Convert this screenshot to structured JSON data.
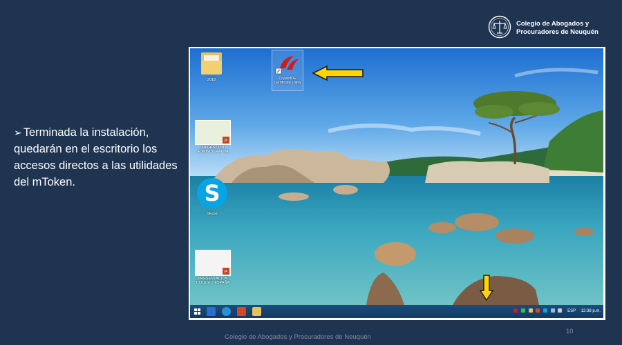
{
  "logo": {
    "line1": "Colegio de Abogados y",
    "line2": "Procuradores de Neuquén"
  },
  "bullet": {
    "marker": "➢",
    "text": "Terminada la instalación, quedarán en el escritorio los accesos directos a las utilidades del mToken."
  },
  "desktop": {
    "icons": {
      "folder": "2018",
      "crypto": "CryptoIDE Certificate Utility",
      "ppt1": "LA GESTIÓN ADMINISTRATIVA",
      "skype": "Skype",
      "ppt2": "PRESENTACIÓN COLEGIO ESPAÑA"
    },
    "taskbar": {
      "lang": "ESP",
      "time": "12:38 p.m."
    }
  },
  "footer": "Colegio de Abogados y Procuradores de Neuquén",
  "page_number": "10",
  "colors": {
    "background": "#1e3451",
    "arrow": "#ffd400",
    "taskbar": "#1b4d7c"
  }
}
